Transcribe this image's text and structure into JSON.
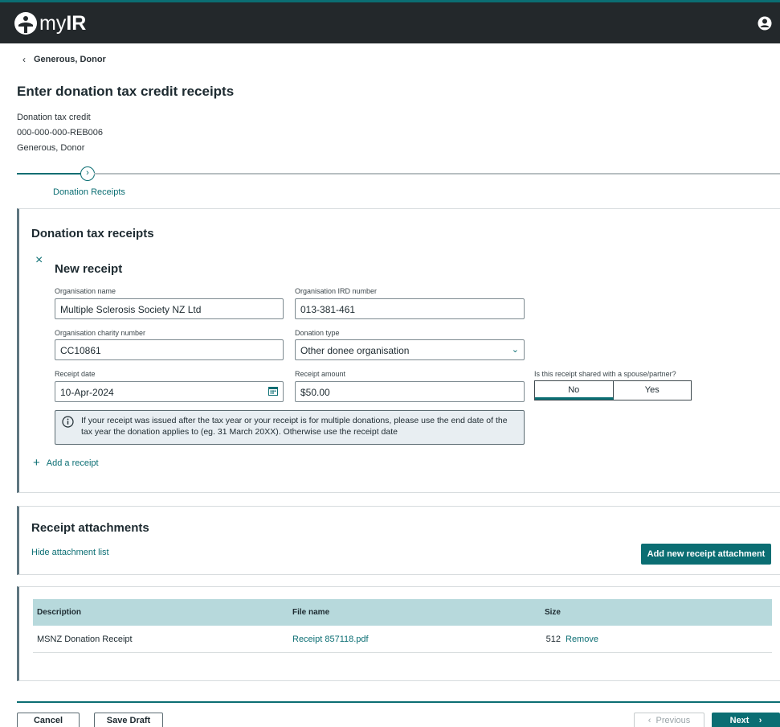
{
  "header": {
    "logo_prefix": "my",
    "logo_bold": "IR"
  },
  "breadcrumb": {
    "back_label": "Generous, Donor"
  },
  "page": {
    "title": "Enter donation tax credit receipts"
  },
  "meta": {
    "line1": "Donation tax credit",
    "line2": "000-000-000-REB006",
    "line3": "Generous, Donor"
  },
  "stepper": {
    "step_label": "Donation Receipts"
  },
  "receipts": {
    "section_title": "Donation tax receipts",
    "subtitle": "New receipt",
    "org_name_label": "Organisation name",
    "org_name_value": "Multiple Sclerosis Society NZ Ltd",
    "org_ird_label": "Organisation IRD number",
    "org_ird_value": "013-381-461",
    "charity_label": "Organisation charity number",
    "charity_value": "CC10861",
    "donation_type_label": "Donation type",
    "donation_type_value": "Other donee organisation",
    "date_label": "Receipt date",
    "date_value": "10-Apr-2024",
    "amount_label": "Receipt amount",
    "amount_value": "$50.00",
    "shared_label": "Is this receipt shared with a spouse/partner?",
    "shared_no": "No",
    "shared_yes": "Yes",
    "info_text": "If your receipt was issued after the tax year or your receipt is for multiple donations, please use the end date of the tax year the donation applies to (eg. 31 March 20XX). Otherwise use the receipt date",
    "add_receipt": "Add a receipt"
  },
  "attachments": {
    "title": "Receipt attachments",
    "hide_link": "Hide attachment list",
    "add_button": "Add new receipt attachment",
    "columns": [
      "Description",
      "File name",
      "Size"
    ],
    "rows": [
      {
        "description": "MSNZ Donation Receipt",
        "file": "Receipt 857118.pdf",
        "size": "512",
        "action": "Remove"
      }
    ]
  },
  "footer": {
    "cancel": "Cancel",
    "save": "Save Draft",
    "previous": "Previous",
    "next": "Next"
  },
  "colors": {
    "accent": "#0b6e73",
    "topbar": "#23282b",
    "table_header": "#b7d9dc"
  }
}
